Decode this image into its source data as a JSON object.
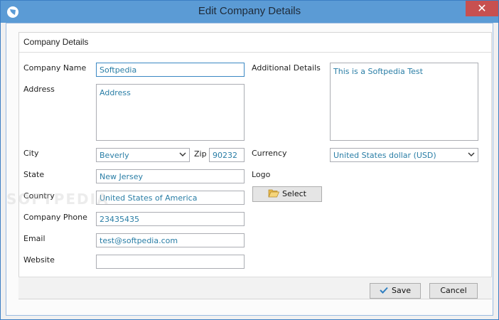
{
  "window": {
    "title": "Edit Company Details",
    "close_glyph": "✕"
  },
  "panel": {
    "title": "Company Details"
  },
  "fields": {
    "company_name": {
      "label": "Company Name",
      "value": "Softpedia"
    },
    "address": {
      "label": "Address",
      "value": "Address"
    },
    "city": {
      "label": "City",
      "value": "Beverly"
    },
    "zip": {
      "label": "Zip",
      "value": "90232"
    },
    "state": {
      "label": "State",
      "value": "New Jersey"
    },
    "country": {
      "label": "Country",
      "value": "United States of America"
    },
    "company_phone": {
      "label": "Company Phone",
      "value": "23435435"
    },
    "email": {
      "label": "Email",
      "value": "test@softpedia.com"
    },
    "website": {
      "label": "Website",
      "value": ""
    },
    "additional_details": {
      "label": "Additional Details",
      "value": "This is a Softpedia Test"
    },
    "currency": {
      "label": "Currency",
      "value": "United States dollar (USD)"
    },
    "logo": {
      "label": "Logo",
      "select_label": "Select"
    }
  },
  "footer": {
    "save_label": "Save",
    "cancel_label": "Cancel"
  },
  "watermark": "SOFTPEDIA",
  "colors": {
    "titlebar": "#5b9bd5",
    "close": "#c75050",
    "value_text": "#2a7ea6",
    "focus_border": "#3b88c3"
  },
  "icons": {
    "app": "app-logo-icon",
    "close": "close-icon",
    "dropdown": "chevron-down-icon",
    "folder": "folder-open-icon",
    "check": "checkmark-icon"
  }
}
